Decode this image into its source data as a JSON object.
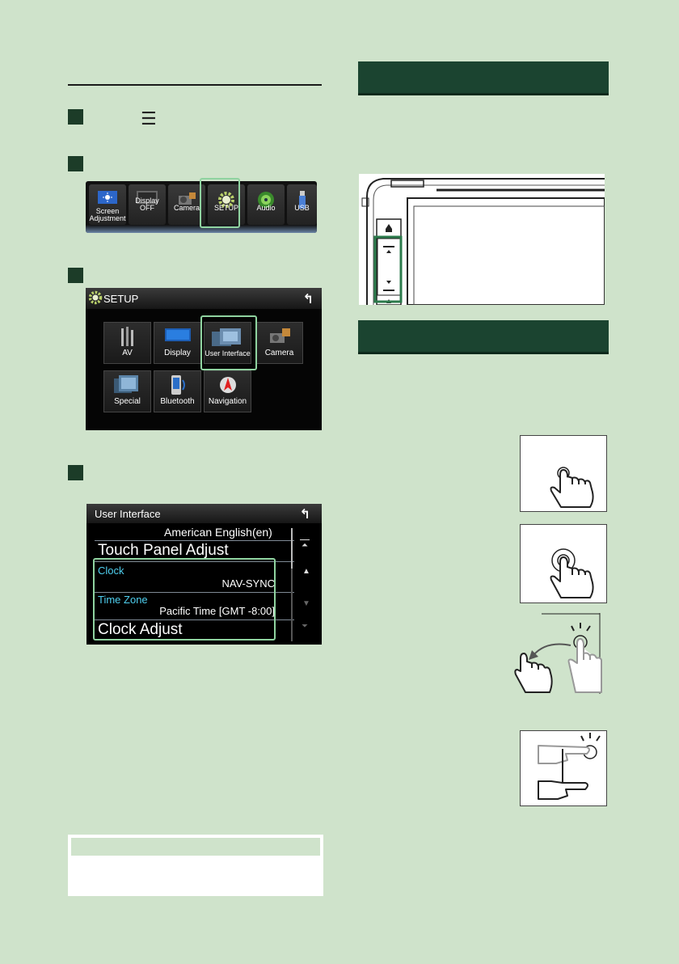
{
  "colors": {
    "page_bg": "#cfe3cb",
    "header_bg": "#1b4430",
    "step_square": "#1c3c28",
    "highlight": "#8fd3a0",
    "clock_label": "#4fd0f0"
  },
  "icons": [
    "menu-icon",
    "screen-adjustment-icon",
    "display-off-icon",
    "camera-icon",
    "gear-icon",
    "audio-icon",
    "usb-icon",
    "back-icon",
    "home-icon",
    "scroll-arrows",
    "tap-gesture",
    "long-press-gesture",
    "flick-gesture",
    "scroll-gesture"
  ],
  "popup_menu": {
    "items": [
      {
        "label_l1": "Screen",
        "label_l2": "Adjustment"
      },
      {
        "label_l1": "",
        "label_l2": "Display OFF"
      },
      {
        "label_l1": "",
        "label_l2": "Camera"
      },
      {
        "label_l1": "",
        "label_l2": "SETUP"
      },
      {
        "label_l1": "",
        "label_l2": "Audio"
      },
      {
        "label_l1": "",
        "label_l2": "USB"
      }
    ]
  },
  "setup_screen": {
    "title": "SETUP",
    "items": [
      "AV",
      "Display",
      "User Interface",
      "Camera",
      "Special",
      "Bluetooth",
      "Navigation"
    ]
  },
  "ui_screen": {
    "title": "User Interface",
    "language_value": "American English(en)",
    "touch_panel": "Touch Panel Adjust",
    "clock_label": "Clock",
    "clock_value": "NAV-SYNC",
    "timezone_label": "Time Zone",
    "timezone_value": "Pacific Time [GMT -8:00]",
    "clock_adjust": "Clock Adjust"
  }
}
